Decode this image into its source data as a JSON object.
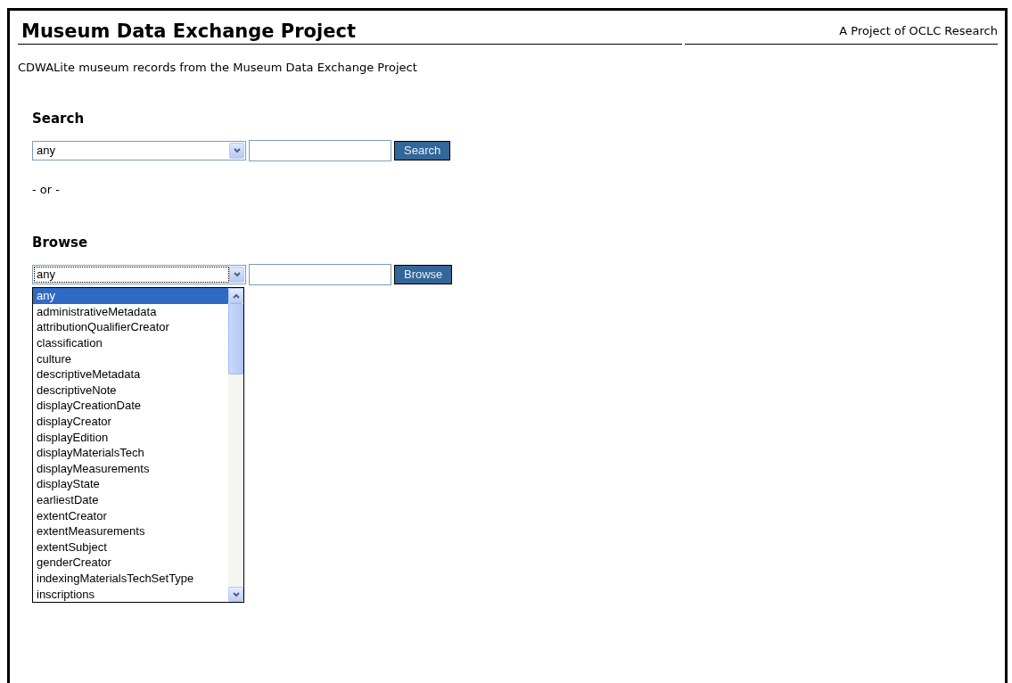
{
  "header": {
    "title": "Museum Data Exchange Project",
    "tagline": "A Project of OCLC Research"
  },
  "intro": "CDWALite museum records from the Museum Data Exchange Project",
  "forms": [
    {
      "heading": "Search",
      "field_select": "any",
      "focused": false,
      "button": "Search"
    },
    {
      "heading": "Browse",
      "field_select": "any",
      "focused": true,
      "button": "Browse",
      "dropdown": {
        "options": [
          {
            "label": "any",
            "selected": true
          },
          {
            "label": "administrativeMetadata",
            "selected": false
          },
          {
            "label": "attributionQualifierCreator",
            "selected": false
          },
          {
            "label": "classification",
            "selected": false
          },
          {
            "label": "culture",
            "selected": false
          },
          {
            "label": "descriptiveMetadata",
            "selected": false
          },
          {
            "label": "descriptiveNote",
            "selected": false
          },
          {
            "label": "displayCreationDate",
            "selected": false
          },
          {
            "label": "displayCreator",
            "selected": false
          },
          {
            "label": "displayEdition",
            "selected": false
          },
          {
            "label": "displayMaterialsTech",
            "selected": false
          },
          {
            "label": "displayMeasurements",
            "selected": false
          },
          {
            "label": "displayState",
            "selected": false
          },
          {
            "label": "earliestDate",
            "selected": false
          },
          {
            "label": "extentCreator",
            "selected": false
          },
          {
            "label": "extentMeasurements",
            "selected": false
          },
          {
            "label": "extentSubject",
            "selected": false
          },
          {
            "label": "genderCreator",
            "selected": false
          },
          {
            "label": "indexingMaterialsTechSetType",
            "selected": false
          },
          {
            "label": "inscriptions",
            "selected": false
          }
        ]
      }
    }
  ],
  "separator": "- or -"
}
